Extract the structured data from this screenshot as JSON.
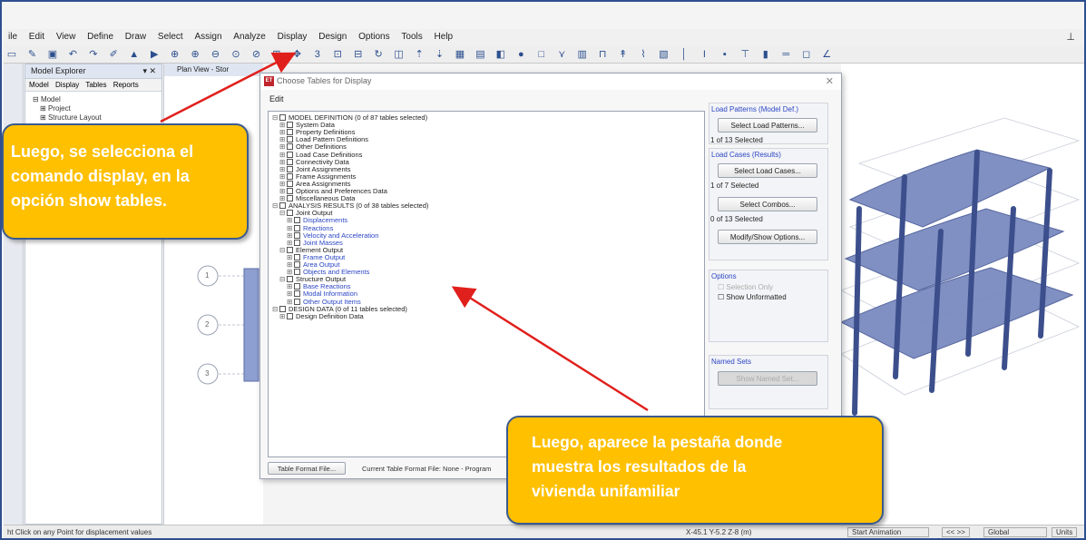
{
  "menu": [
    "ile",
    "Edit",
    "View",
    "Define",
    "Draw",
    "Select",
    "Assign",
    "Analyze",
    "Display",
    "Design",
    "Options",
    "Tools",
    "Help"
  ],
  "explorer": {
    "title": "Model Explorer",
    "tabs": [
      "Model",
      "Display",
      "Tables",
      "Reports"
    ],
    "tree": [
      "Model",
      "Project",
      "Structure Layout"
    ]
  },
  "planview": {
    "title": "Plan View - Stor",
    "grid_labels": [
      "1",
      "2",
      "3"
    ]
  },
  "dialog": {
    "title": "Choose Tables for Display",
    "menu": "Edit",
    "tree": [
      {
        "text": "MODEL DEFINITION  (0 of 87 tables selected)",
        "level": 0,
        "blue": false
      },
      {
        "text": "System Data",
        "level": 1,
        "blue": false
      },
      {
        "text": "Property Definitions",
        "level": 1,
        "blue": false
      },
      {
        "text": "Load Pattern Definitions",
        "level": 1,
        "blue": false
      },
      {
        "text": "Other Definitions",
        "level": 1,
        "blue": false
      },
      {
        "text": "Load Case Definitions",
        "level": 1,
        "blue": false
      },
      {
        "text": "Connectivity Data",
        "level": 1,
        "blue": false
      },
      {
        "text": "Joint Assignments",
        "level": 1,
        "blue": false
      },
      {
        "text": "Frame Assignments",
        "level": 1,
        "blue": false
      },
      {
        "text": "Area Assignments",
        "level": 1,
        "blue": false
      },
      {
        "text": "Options and Preferences Data",
        "level": 1,
        "blue": false
      },
      {
        "text": "Miscellaneous Data",
        "level": 1,
        "blue": false
      },
      {
        "text": "ANALYSIS RESULTS  (0 of 38 tables selected)",
        "level": 0,
        "blue": false
      },
      {
        "text": "Joint Output",
        "level": 1,
        "blue": false
      },
      {
        "text": "Displacements",
        "level": 2,
        "blue": true
      },
      {
        "text": "Reactions",
        "level": 2,
        "blue": true
      },
      {
        "text": "Velocity and Acceleration",
        "level": 2,
        "blue": true
      },
      {
        "text": "Joint Masses",
        "level": 2,
        "blue": true
      },
      {
        "text": "Element Output",
        "level": 1,
        "blue": false
      },
      {
        "text": "Frame Output",
        "level": 2,
        "blue": true
      },
      {
        "text": "Area Output",
        "level": 2,
        "blue": true
      },
      {
        "text": "Objects and Elements",
        "level": 2,
        "blue": true
      },
      {
        "text": "Structure Output",
        "level": 1,
        "blue": false
      },
      {
        "text": "Base Reactions",
        "level": 2,
        "blue": true
      },
      {
        "text": "Modal Information",
        "level": 2,
        "blue": true
      },
      {
        "text": "Other Output Items",
        "level": 2,
        "blue": true
      },
      {
        "text": "DESIGN DATA  (0 of 11 tables selected)",
        "level": 0,
        "blue": false
      },
      {
        "text": "Design Definition Data",
        "level": 1,
        "blue": false
      }
    ],
    "load_patterns": {
      "title": "Load Patterns (Model Def.)",
      "button": "Select Load Patterns...",
      "count": "1 of 13 Selected"
    },
    "load_cases": {
      "title": "Load Cases (Results)",
      "button": "Select Load Cases...",
      "count": "1 of 7 Selected"
    },
    "combos": {
      "button": "Select Combos...",
      "count": "0 of 13 Selected"
    },
    "modify_button": "Modify/Show Options...",
    "options": {
      "title": "Options",
      "selection_only": "Selection Only",
      "show_unformatted": "Show Unformatted"
    },
    "named_sets": {
      "title": "Named Sets",
      "button": "Show Named Set..."
    },
    "format_button": "Table Format File...",
    "format_text": "Current Table Format File:  None - Program"
  },
  "statusbar": {
    "left": "ht Click on any Point for displacement values",
    "coords": "X-45.1  Y-5.2  Z-8 (m)",
    "animation": "Start Animation",
    "nav": "<<   >>",
    "coord_sys": "Global",
    "units": "Units"
  },
  "callouts": {
    "first": [
      "Luego, se selecciona el",
      "comando display, en la",
      "opción show tables."
    ],
    "second": [
      "Luego, aparece la pestaña donde",
      "muestra los resultados de la",
      "vivienda unifamiliar"
    ]
  },
  "colors": {
    "callout_fill": "#ffc000",
    "callout_border": "#3b5b8f",
    "arrow": "#e0201c",
    "link_blue": "#2b46c4",
    "frame_blue": "#5a6ea8"
  }
}
